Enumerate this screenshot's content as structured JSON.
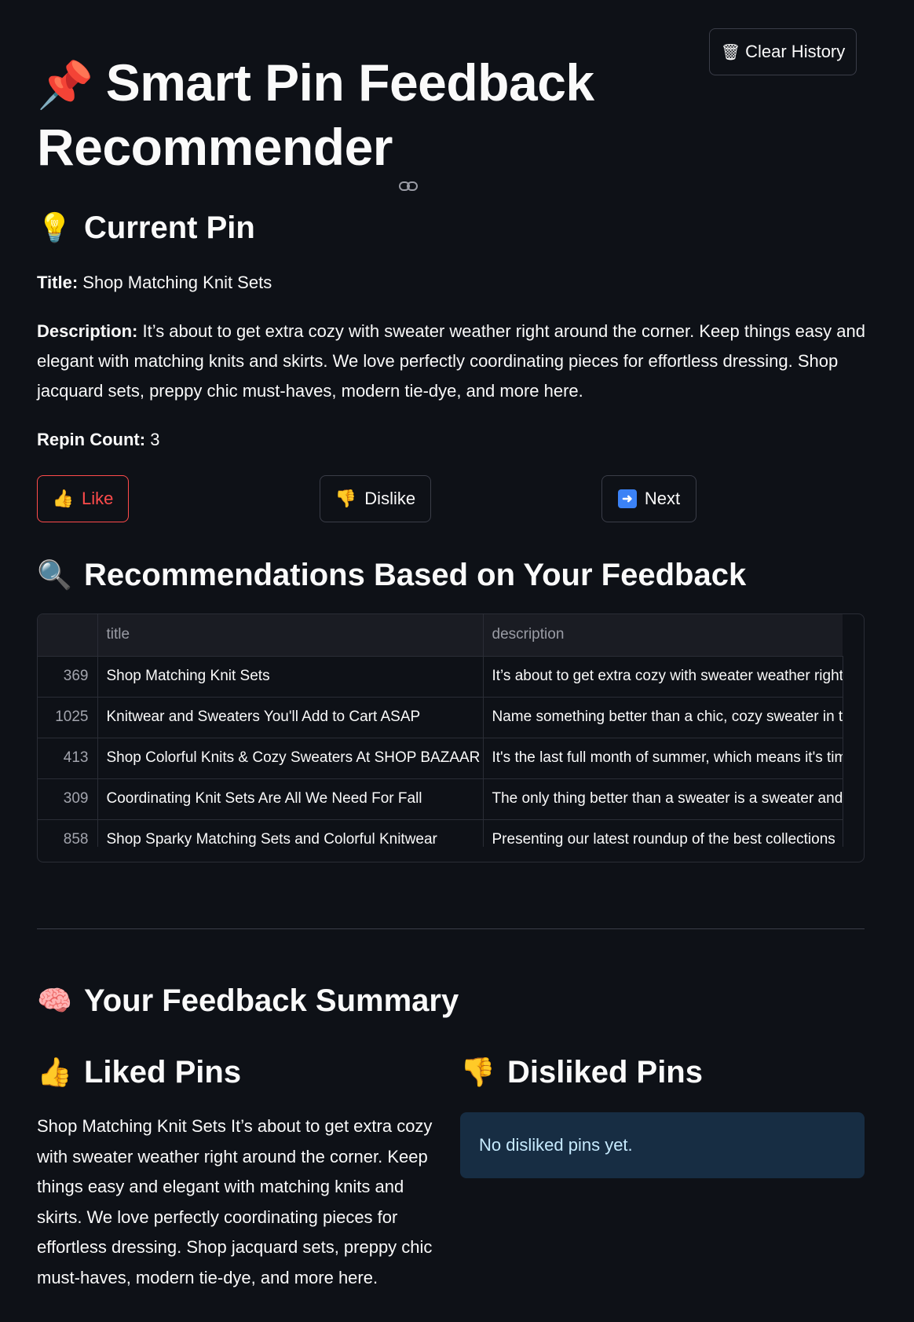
{
  "header": {
    "clear_history_label": "Clear History",
    "clear_history_icon": "wastebasket-icon",
    "title": "Smart Pin Feedback Recommender",
    "title_icon": "pushpin-icon"
  },
  "current_pin": {
    "heading": "Current Pin",
    "heading_icon": "light-bulb-icon",
    "title_label": "Title:",
    "title_value": "Shop Matching Knit Sets",
    "description_label": "Description:",
    "description_value": "It’s about to get extra cozy with sweater weather right around the corner. Keep things easy and elegant with matching knits and skirts. We love perfectly coordinating pieces for effortless dressing. Shop jacquard sets, preppy chic must-haves, modern tie-dye, and more here.",
    "repin_label": "Repin Count:",
    "repin_value": "3"
  },
  "actions": {
    "like_label": "Like",
    "dislike_label": "Dislike",
    "next_label": "Next"
  },
  "recommendations": {
    "heading": "Recommendations Based on Your Feedback",
    "heading_icon": "magnifying-glass-icon",
    "columns": [
      "",
      "title",
      "description"
    ],
    "rows": [
      {
        "index": "369",
        "title": "Shop Matching Knit Sets",
        "description": "It’s about to get extra cozy with sweater weather right around the corner"
      },
      {
        "index": "1025",
        "title": "Knitwear and Sweaters You'll Add to Cart ASAP",
        "description": "Name something better than a chic, cozy sweater in the fall"
      },
      {
        "index": "413",
        "title": "Shop Colorful Knits & Cozy Sweaters At SHOP BAZAAR",
        "description": "It's the last full month of summer, which means it's time"
      },
      {
        "index": "309",
        "title": "Coordinating Knit Sets Are All We Need For Fall",
        "description": "The only thing better than a sweater is a sweater and matching skirt"
      },
      {
        "index": "858",
        "title": "Shop Sparky Matching Sets and Colorful Knitwear",
        "description": "Presenting our latest roundup of the best collections"
      }
    ]
  },
  "feedback_summary": {
    "heading": "Your Feedback Summary",
    "heading_icon": "brain-icon",
    "liked_heading": "Liked Pins",
    "liked_text": "Shop Matching Knit Sets It’s about to get extra cozy with sweater weather right around the corner. Keep things easy and elegant with matching knits and skirts. We love perfectly coordinating pieces for effortless dressing. Shop jacquard sets, preppy chic must-haves, modern tie-dye, and more here.",
    "disliked_heading": "Disliked Pins",
    "disliked_empty": "No disliked pins yet."
  },
  "colors": {
    "background": "#0e1117",
    "primary_accent": "#ff4b4b",
    "info_bg": "#172d43",
    "info_text": "#c7ebff"
  }
}
